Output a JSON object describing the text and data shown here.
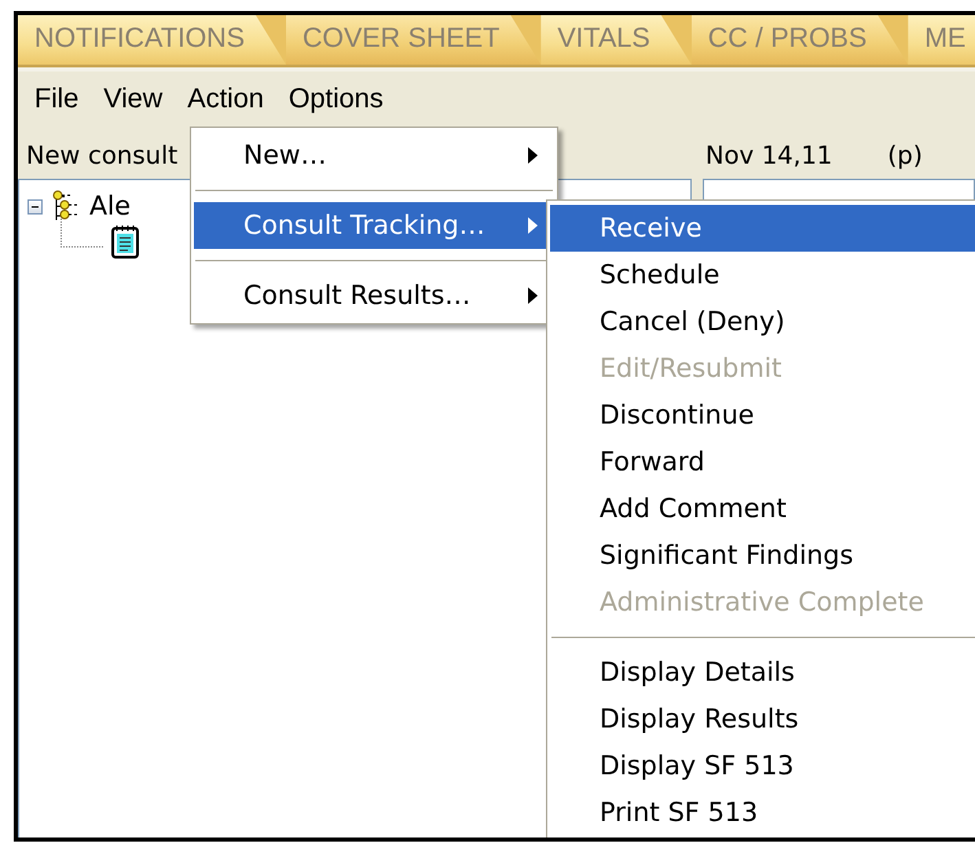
{
  "tabs": [
    {
      "label": "NOTIFICATIONS"
    },
    {
      "label": "COVER SHEET"
    },
    {
      "label": "VITALS"
    },
    {
      "label": "CC / PROBS"
    },
    {
      "label": "ME"
    }
  ],
  "menu_bar": [
    {
      "label": "File"
    },
    {
      "label": "View"
    },
    {
      "label": "Action"
    },
    {
      "label": "Options"
    }
  ],
  "left_pane": {
    "header": "New consult",
    "tree": [
      {
        "label": "Ale",
        "expanded": true,
        "children": [
          {
            "kind": "document"
          }
        ]
      }
    ]
  },
  "right_pane": {
    "date": "Nov 14,11",
    "flag": "(p)"
  },
  "action_menu": {
    "items": [
      {
        "kind": "item",
        "label": "New…",
        "submenu": true,
        "selected": false,
        "disabled": false
      },
      {
        "kind": "separator"
      },
      {
        "kind": "item",
        "label": "Consult Tracking…",
        "submenu": true,
        "selected": true,
        "disabled": false
      },
      {
        "kind": "separator"
      },
      {
        "kind": "item",
        "label": "Consult Results…",
        "submenu": true,
        "selected": false,
        "disabled": false
      }
    ]
  },
  "tracking_submenu": {
    "items": [
      {
        "kind": "item",
        "label": "Receive",
        "submenu": false,
        "selected": true,
        "disabled": false
      },
      {
        "kind": "item",
        "label": "Schedule",
        "submenu": false,
        "selected": false,
        "disabled": false
      },
      {
        "kind": "item",
        "label": "Cancel (Deny)",
        "submenu": false,
        "selected": false,
        "disabled": false
      },
      {
        "kind": "item",
        "label": "Edit/Resubmit",
        "submenu": false,
        "selected": false,
        "disabled": true
      },
      {
        "kind": "item",
        "label": "Discontinue",
        "submenu": false,
        "selected": false,
        "disabled": false
      },
      {
        "kind": "item",
        "label": "Forward",
        "submenu": false,
        "selected": false,
        "disabled": false
      },
      {
        "kind": "item",
        "label": "Add Comment",
        "submenu": false,
        "selected": false,
        "disabled": false
      },
      {
        "kind": "item",
        "label": "Significant Findings",
        "submenu": false,
        "selected": false,
        "disabled": false
      },
      {
        "kind": "item",
        "label": "Administrative Complete",
        "submenu": false,
        "selected": false,
        "disabled": true
      },
      {
        "kind": "separator"
      },
      {
        "kind": "item",
        "label": "Display Details",
        "submenu": false,
        "selected": false,
        "disabled": false
      },
      {
        "kind": "item",
        "label": "Display Results",
        "submenu": false,
        "selected": false,
        "disabled": false
      },
      {
        "kind": "item",
        "label": "Display SF 513",
        "submenu": false,
        "selected": false,
        "disabled": false
      },
      {
        "kind": "item",
        "label": "Print SF 513",
        "submenu": false,
        "selected": false,
        "disabled": false
      }
    ]
  }
}
